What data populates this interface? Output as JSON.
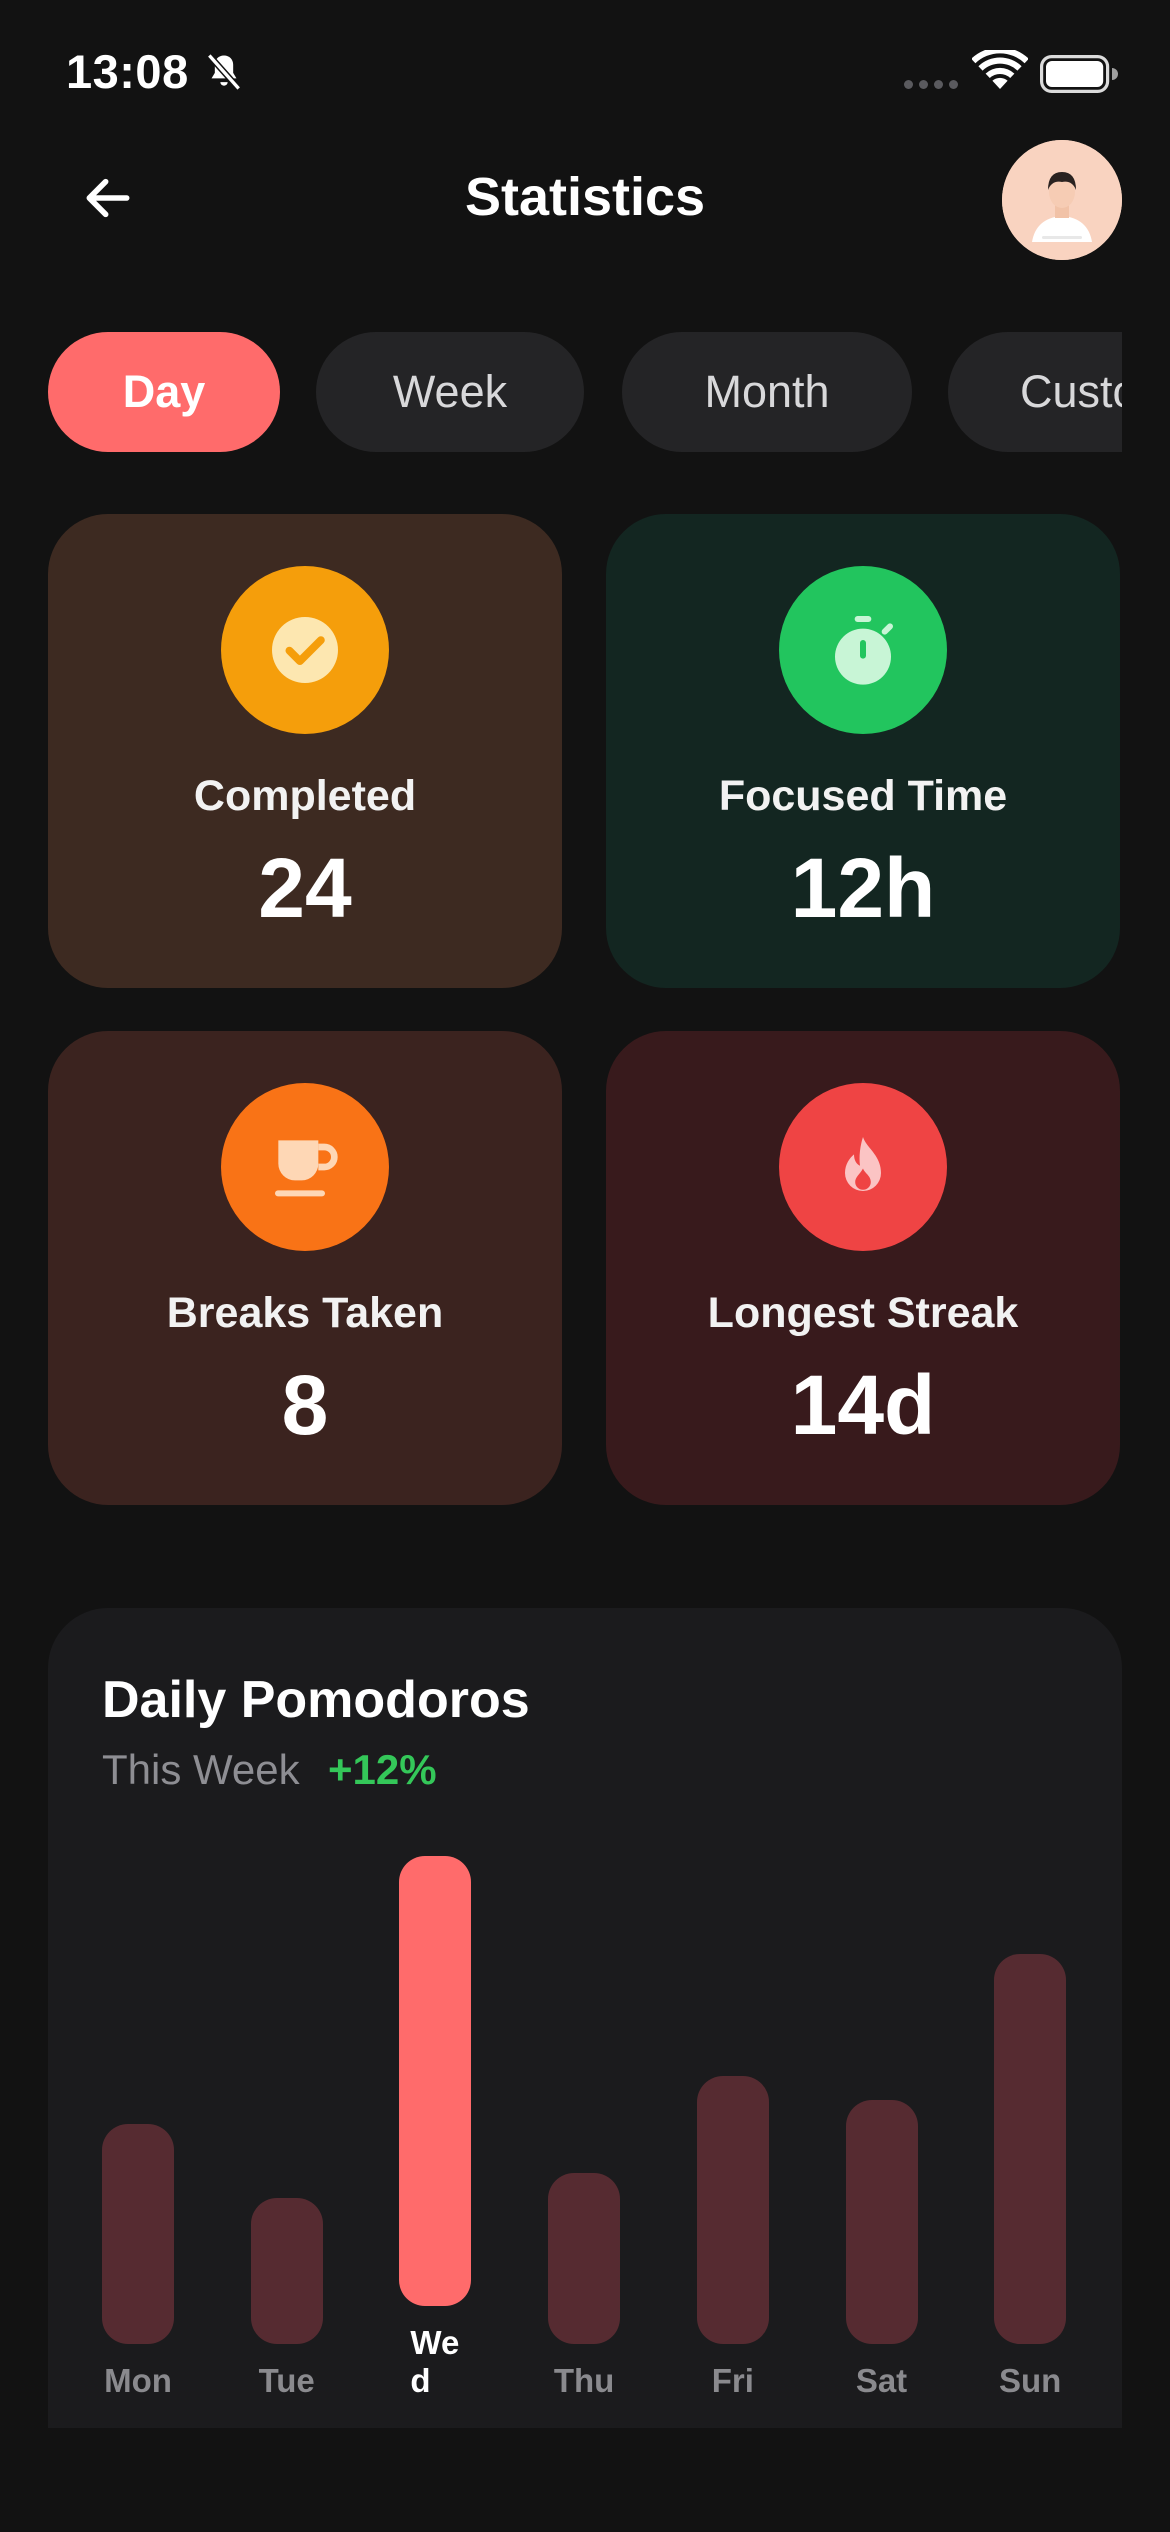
{
  "status_bar": {
    "time": "13:08"
  },
  "header": {
    "title": "Statistics"
  },
  "tabs": [
    {
      "label": "Day",
      "active": true
    },
    {
      "label": "Week",
      "active": false
    },
    {
      "label": "Month",
      "active": false
    },
    {
      "label": "Custom",
      "active": false
    }
  ],
  "stats": [
    {
      "label": "Completed",
      "value": "24",
      "icon": "check-circle-icon",
      "card_color": "#3d2a21",
      "icon_color": "#f59e0b"
    },
    {
      "label": "Focused Time",
      "value": "12h",
      "icon": "stopwatch-icon",
      "card_color": "#132621",
      "icon_color": "#22c55e"
    },
    {
      "label": "Breaks Taken",
      "value": "8",
      "icon": "coffee-cup-icon",
      "card_color": "#3b231f",
      "icon_color": "#f97316"
    },
    {
      "label": "Longest Streak",
      "value": "14d",
      "icon": "flame-icon",
      "card_color": "#381a1c",
      "icon_color": "#ef4444"
    }
  ],
  "chart": {
    "title": "Daily Pomodoros",
    "subtitle": "This Week",
    "change": "+12%",
    "active_color": "#ff6b6b",
    "inactive_color": "#562b31"
  },
  "chart_data": {
    "type": "bar",
    "categories": [
      "Mon",
      "Tue",
      "Wed",
      "Thu",
      "Fri",
      "Sat",
      "Sun"
    ],
    "values": [
      45,
      30,
      100,
      35,
      55,
      50,
      80
    ],
    "highlighted": "Wed",
    "title": "Daily Pomodoros",
    "xlabel": "",
    "ylabel": ""
  }
}
